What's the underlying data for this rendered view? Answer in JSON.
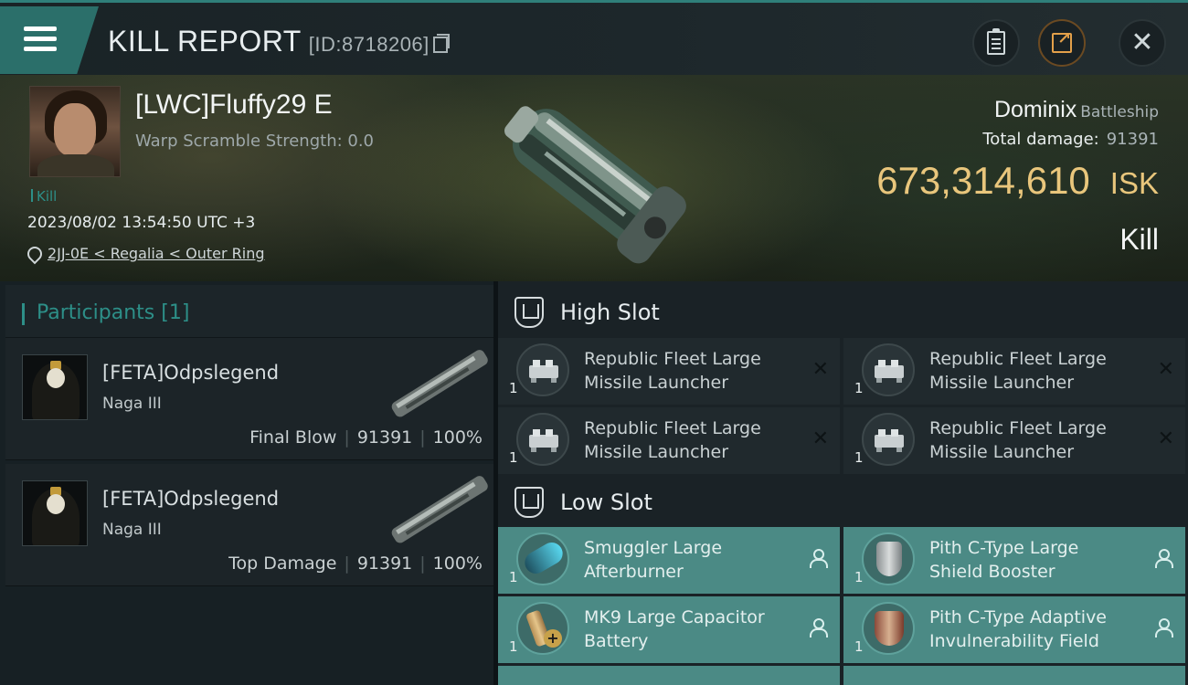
{
  "header": {
    "title": "KILL REPORT",
    "report_id": "[ID:8718206]"
  },
  "victim": {
    "name": "[LWC]Fluffy29 E",
    "warp_scramble": "Warp Scramble Strength: 0.0",
    "tag": "Kill",
    "datetime": "2023/08/02 13:54:50 UTC +3",
    "location": "2JJ-0E < Regalia < Outer Ring",
    "ship": "Dominix",
    "ship_class": "Battleship",
    "total_damage_label": "Total damage:",
    "total_damage": "91391",
    "isk_value": "673,314,610",
    "isk_unit": "ISK",
    "result": "Kill"
  },
  "participants": {
    "label": "Participants",
    "count": "[1]",
    "items": [
      {
        "name": "[FETA]Odpslegend",
        "ship": "Naga III",
        "role": "Final Blow",
        "damage": "91391",
        "percent": "100%"
      },
      {
        "name": "[FETA]Odpslegend",
        "ship": "Naga III",
        "role": "Top Damage",
        "damage": "91391",
        "percent": "100%"
      }
    ]
  },
  "high_slot": {
    "label": "High Slot",
    "items": [
      {
        "line1": "Republic Fleet Large",
        "line2": "Missile Launcher",
        "qty": "1"
      },
      {
        "line1": "Republic Fleet Large",
        "line2": "Missile Launcher",
        "qty": "1"
      },
      {
        "line1": "Republic Fleet Large",
        "line2": "Missile Launcher",
        "qty": "1"
      },
      {
        "line1": "Republic Fleet Large",
        "line2": "Missile Launcher",
        "qty": "1"
      }
    ]
  },
  "low_slot": {
    "label": "Low Slot",
    "items": [
      {
        "line1": "Smuggler Large",
        "line2": "Afterburner",
        "qty": "1"
      },
      {
        "line1": "Pith C-Type Large",
        "line2": "Shield Booster",
        "qty": "1"
      },
      {
        "line1": "MK9 Large Capacitor",
        "line2": "Battery",
        "qty": "1"
      },
      {
        "line1": "Pith C-Type Adaptive",
        "line2": "Invulnerability Field",
        "qty": "1"
      }
    ]
  },
  "icons": [
    "menu-icon",
    "copy-icon",
    "clipboard-icon",
    "share-icon",
    "close-icon",
    "location-pin-icon",
    "slot-shield-icon",
    "destroyed-x-icon",
    "dropped-person-icon"
  ],
  "colors": {
    "accent": "#2d8f88",
    "isk": "#e9c67c",
    "low_slot_bg": "#4b8a85"
  }
}
